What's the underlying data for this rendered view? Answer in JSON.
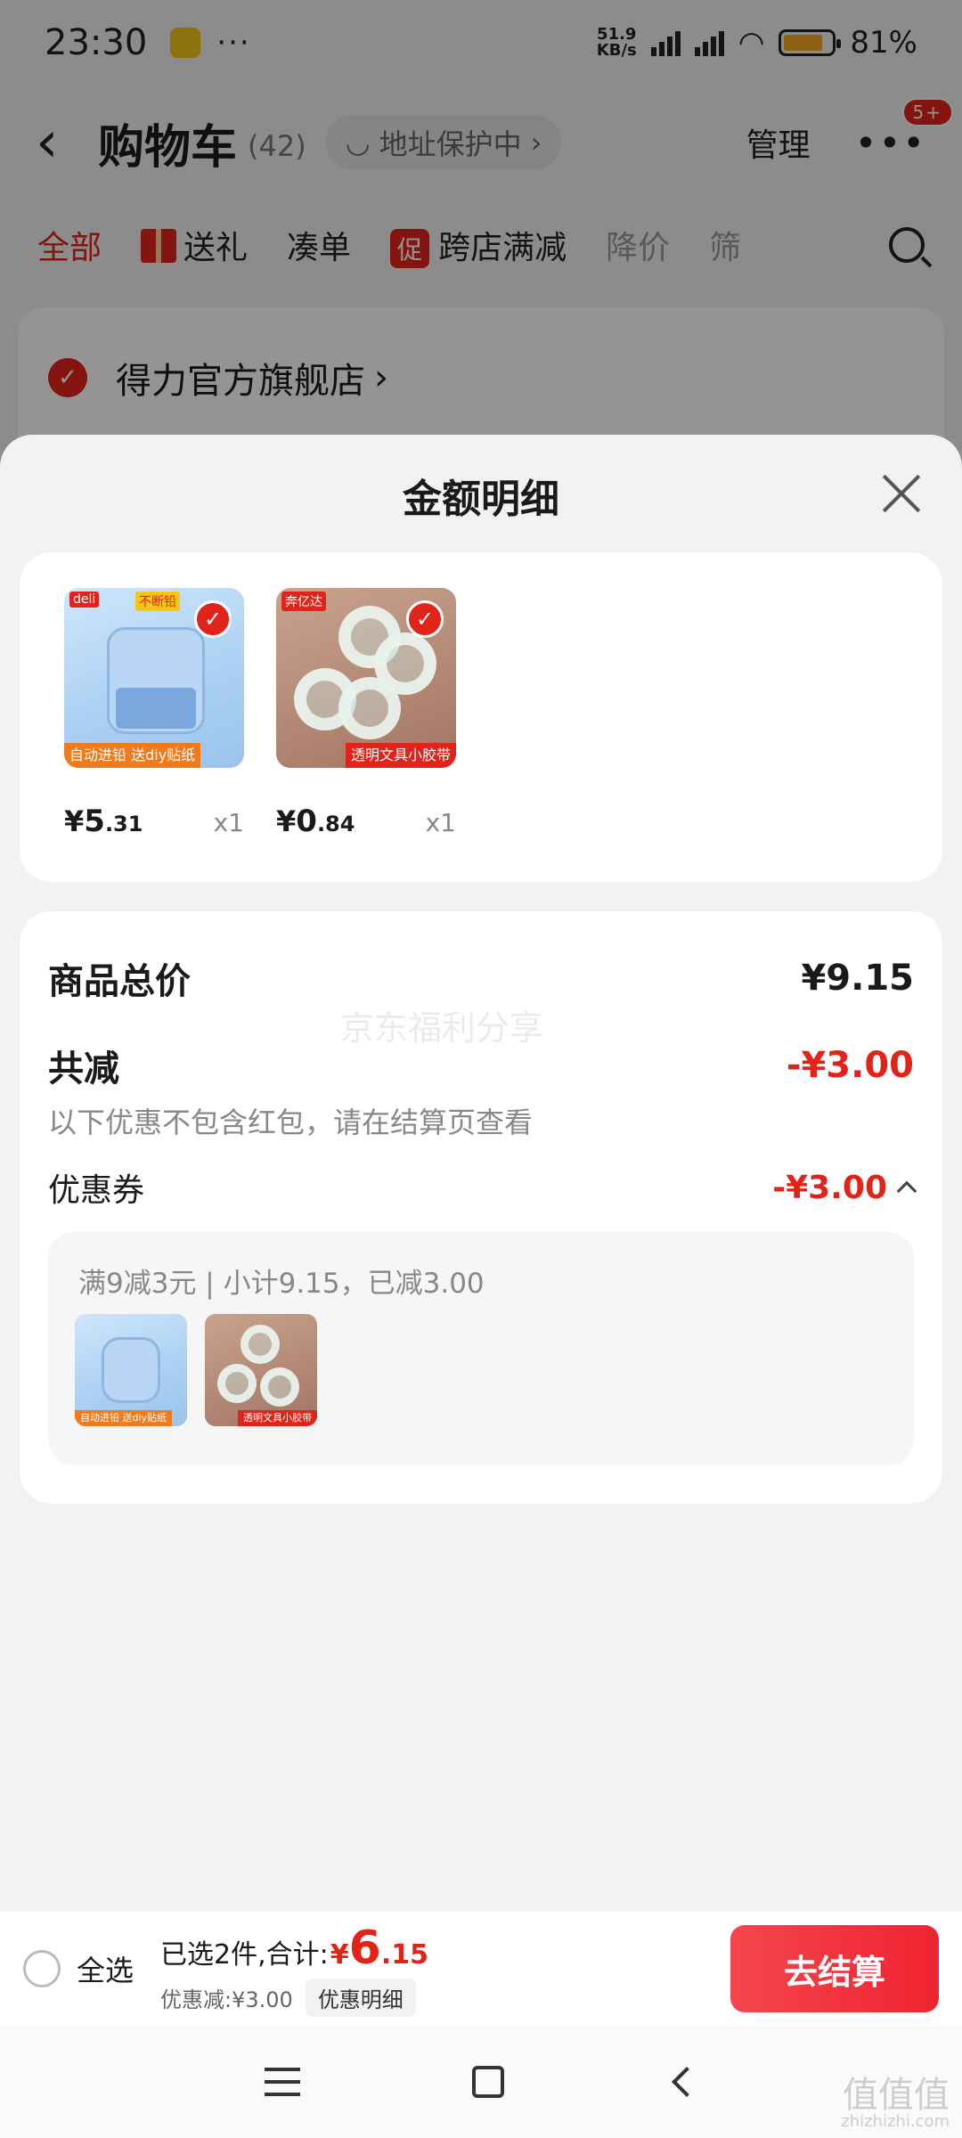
{
  "status_bar": {
    "time": "23:30",
    "more": "···",
    "net_speed_value": "51.9",
    "net_speed_unit": "KB/s",
    "battery": "81%",
    "battery_level": 0.81
  },
  "header": {
    "title": "购物车",
    "count": "(42)",
    "address_status": "地址保护中",
    "manage": "管理",
    "more_badge": "5+"
  },
  "filter_tabs": [
    {
      "label": "全部"
    },
    {
      "label": "送礼"
    },
    {
      "label": "凑单"
    },
    {
      "label": "跨店满减",
      "icon_text": "促"
    },
    {
      "label": "降价"
    },
    {
      "label": "筛"
    }
  ],
  "store": {
    "name": "得力官方旗舰店"
  },
  "sheet": {
    "title": "金额明细",
    "items": [
      {
        "name_icon": "pencil-sharpener-thumbnail",
        "top_label": "不断铅",
        "brand": "deli",
        "tag": "自动进铅 送diy贴纸",
        "price_yen": "¥",
        "price_int": "5",
        "price_dec": ".31",
        "qty": "x1"
      },
      {
        "name_icon": "tape-thumbnail",
        "top_label": "奔亿达",
        "tag": "透明文具小胶带",
        "price_yen": "¥",
        "price_int": "0",
        "price_dec": ".84",
        "qty": "x1"
      }
    ],
    "summary": {
      "total_label": "商品总价",
      "total_value": "¥9.15",
      "watermark": "京东福利分享",
      "reduction_label": "共减",
      "reduction_value": "-¥3.00",
      "hint": "以下优惠不包含红包，请在结算页查看",
      "coupon_label": "优惠券",
      "coupon_value": "-¥3.00",
      "coupon_rule": "满9减3元 | 小计9.15，已减3.00"
    }
  },
  "bottom_bar": {
    "select_all": "全选",
    "selected_text": "已选2件,合计:",
    "total_yen": "¥",
    "total_int": "6",
    "total_dec": ".15",
    "discount_text": "优惠减:¥3.00",
    "detail_button": "优惠明细",
    "checkout": "去结算"
  },
  "corner_logo": {
    "text": "值值值",
    "url_text": "zhizhizhi.com"
  },
  "colors": {
    "accent_red": "#e2231a",
    "checkout_gradient_start": "#f5464d",
    "checkout_gradient_end": "#ef2330"
  }
}
